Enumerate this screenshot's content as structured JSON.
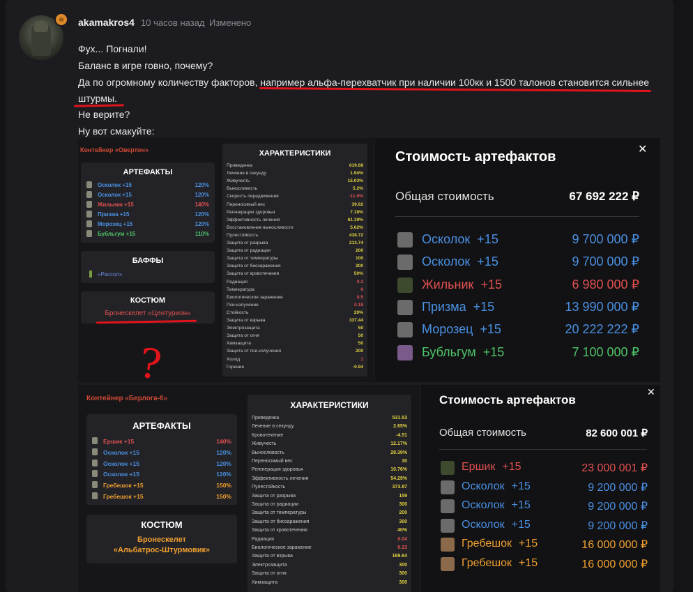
{
  "post": {
    "username": "akamakros4",
    "time": "10 часов назад",
    "edited": "Изменено",
    "badge_icon": "skull-icon",
    "lines": [
      "Фух... Погнали!",
      "Баланс в игре говно, почему?",
      "Да по огромному количеству факторов, например альфа-перехватчик при наличии 100кк и 1500 талонов становится сильнее",
      "штурмы.",
      "Не верите?",
      "Ну вот смакуйте:"
    ],
    "highlight_color": "#e0141a"
  },
  "shot1": {
    "container": "Контейнер «Овертон»",
    "artifacts_title": "АРТЕФАКТЫ",
    "artifacts": [
      {
        "name": "Осколок +15",
        "pct": "120%",
        "color": "#4a90e2"
      },
      {
        "name": "Осколок +15",
        "pct": "120%",
        "color": "#4a90e2"
      },
      {
        "name": "Жильник +15",
        "pct": "140%",
        "color": "#e05050"
      },
      {
        "name": "Призма +15",
        "pct": "120%",
        "color": "#4a90e2"
      },
      {
        "name": "Морозец +15",
        "pct": "120%",
        "color": "#4a90e2"
      },
      {
        "name": "Бубльгум +15",
        "pct": "110%",
        "color": "#4fc46a"
      }
    ],
    "buffs_title": "БАФФЫ",
    "buff": "«Рассол»",
    "suit_title": "КОСТЮМ",
    "suit": "Бронескелет «Центурион»",
    "stats_title": "ХАРАКТЕРИСТИКИ",
    "stats": [
      [
        "Приведенка",
        "619.68",
        "#e0d040"
      ],
      [
        "Лечение в секунду",
        "1.94%",
        "#e0d040"
      ],
      [
        "Живучесть",
        "15.03%",
        "#e0d040"
      ],
      [
        "Выносливость",
        "5.2%",
        "#e0d040"
      ],
      [
        "Скорость передвижения",
        "-11.9%",
        "#e05050"
      ],
      [
        "Переносимый вес",
        "39.92",
        "#e0d040"
      ],
      [
        "Регенерация здоровья",
        "7.18%",
        "#e0d040"
      ],
      [
        "Эффективность лечения",
        "61.19%",
        "#e0d040"
      ],
      [
        "Восстановление выносливости",
        "5.62%",
        "#e0d040"
      ],
      [
        "Пулестойкость",
        "438.72",
        "#e0d040"
      ],
      [
        "Защита от разрыва",
        "213.74",
        "#e0d040"
      ],
      [
        "Защита от радиации",
        "200",
        "#e0d040"
      ],
      [
        "Защита от температуры",
        "100",
        "#e0d040"
      ],
      [
        "Защита от биозаражения",
        "200",
        "#e0d040"
      ],
      [
        "Защита от кровотечения",
        "50%",
        "#e0d040"
      ],
      [
        "Радиация",
        "0.3",
        "#e05050"
      ],
      [
        "Температура",
        "0",
        "#e05050"
      ],
      [
        "Биологическое заражение",
        "0.5",
        "#e05050"
      ],
      [
        "Пси-излучение",
        "0.18",
        "#e05050"
      ],
      [
        "Стойкость",
        "20%",
        "#e0d040"
      ],
      [
        "Защита от взрыва",
        "337.44",
        "#e0d040"
      ],
      [
        "Электрозащита",
        "50",
        "#e0d040"
      ],
      [
        "Защита от огня",
        "50",
        "#e0d040"
      ],
      [
        "Химзащита",
        "50",
        "#e0d040"
      ],
      [
        "Защита от пси-излучения",
        "200",
        "#e0d040"
      ],
      [
        "Холод",
        "1",
        "#e05050"
      ],
      [
        "Горение",
        "-0.94",
        "#e0d040"
      ]
    ],
    "cost_title": "Стоимость артефактов",
    "close": "✕",
    "total_label": "Общая стоимость",
    "total_value": "67 692 222 ₽",
    "costs": [
      {
        "name": "Осколок",
        "lvl": "+15",
        "value": "9 700 000 ₽",
        "color": "#4a90e2",
        "icon": "shard-icon"
      },
      {
        "name": "Осколок",
        "lvl": "+15",
        "value": "9 700 000 ₽",
        "color": "#4a90e2",
        "icon": "shard-icon"
      },
      {
        "name": "Жильник",
        "lvl": "+15",
        "value": "6 980 000 ₽",
        "color": "#e05050",
        "icon": "vein-icon"
      },
      {
        "name": "Призма",
        "lvl": "+15",
        "value": "13 990 000 ₽",
        "color": "#4a90e2",
        "icon": "prism-icon"
      },
      {
        "name": "Морозец",
        "lvl": "+15",
        "value": "20 222 222 ₽",
        "color": "#4a90e2",
        "icon": "frost-icon"
      },
      {
        "name": "Бубльгум",
        "lvl": "+15",
        "value": "7 100 000 ₽",
        "color": "#4fc46a",
        "icon": "bubblegum-icon"
      }
    ]
  },
  "shot2": {
    "container": "Контейнер «Берлога-6»",
    "artifacts_title": "АРТЕФАКТЫ",
    "artifacts": [
      {
        "name": "Ершик +15",
        "pct": "140%",
        "color": "#e05050"
      },
      {
        "name": "Осколок +15",
        "pct": "120%",
        "color": "#4a90e2"
      },
      {
        "name": "Осколок +15",
        "pct": "120%",
        "color": "#4a90e2"
      },
      {
        "name": "Осколок +15",
        "pct": "120%",
        "color": "#4a90e2"
      },
      {
        "name": "Гребешок +15",
        "pct": "150%",
        "color": "#f0a030"
      },
      {
        "name": "Гребешок +15",
        "pct": "150%",
        "color": "#f0a030"
      }
    ],
    "suit_title": "КОСТЮМ",
    "suit_line1": "Бронескелет",
    "suit_line2": "«Альбатрос-Штурмовик»",
    "stats_title": "ХАРАКТЕРИСТИКИ",
    "stats": [
      [
        "Приведенка",
        "531.53",
        "#e0d040"
      ],
      [
        "Лечение в секунду",
        "2.65%",
        "#e0d040"
      ],
      [
        "Кровотечение",
        "-4.51",
        "#e0d040"
      ],
      [
        "Живучесть",
        "12.17%",
        "#e0d040"
      ],
      [
        "Выносливость",
        "28.39%",
        "#e0d040"
      ],
      [
        "Переносимый вес",
        "30",
        "#e0d040"
      ],
      [
        "Регенерация здоровья",
        "10.76%",
        "#e0d040"
      ],
      [
        "Эффективность лечения",
        "54.29%",
        "#e0d040"
      ],
      [
        "Пулестойкость",
        "373.87",
        "#e0d040"
      ],
      [
        "Защита от разрыва",
        "159",
        "#e0d040"
      ],
      [
        "Защита от радиации",
        "300",
        "#e0d040"
      ],
      [
        "Защита от температуры",
        "200",
        "#e0d040"
      ],
      [
        "Защита от биозаражения",
        "300",
        "#e0d040"
      ],
      [
        "Защита от кровотечения",
        "40%",
        "#e0d040"
      ],
      [
        "Радиация",
        "0.04",
        "#e05050"
      ],
      [
        "Биологическое заражение",
        "0.23",
        "#e05050"
      ],
      [
        "Защита от взрыва",
        "169.64",
        "#e0d040"
      ],
      [
        "Электрозащита",
        "300",
        "#e0d040"
      ],
      [
        "Защита от огня",
        "300",
        "#e0d040"
      ],
      [
        "Химзащита",
        "300",
        "#e0d040"
      ]
    ],
    "cost_title": "Стоимость артефактов",
    "close": "✕",
    "total_label": "Общая стоимость",
    "total_value": "82 600 001 ₽",
    "costs": [
      {
        "name": "Ершик",
        "lvl": "+15",
        "value": "23 000 001 ₽",
        "color": "#e05050",
        "icon": "urchin-icon"
      },
      {
        "name": "Осколок",
        "lvl": "+15",
        "value": "9 200 000 ₽",
        "color": "#4a90e2",
        "icon": "shard-icon"
      },
      {
        "name": "Осколок",
        "lvl": "+15",
        "value": "9 200 000 ₽",
        "color": "#4a90e2",
        "icon": "shard-icon"
      },
      {
        "name": "Осколок",
        "lvl": "+15",
        "value": "9 200 000 ₽",
        "color": "#4a90e2",
        "icon": "shard-icon"
      },
      {
        "name": "Гребешок",
        "lvl": "+15",
        "value": "16 000 000 ₽",
        "color": "#f0a030",
        "icon": "comb-icon"
      },
      {
        "name": "Гребешок",
        "lvl": "+15",
        "value": "16 000 000 ₽",
        "color": "#f0a030",
        "icon": "comb-icon"
      }
    ]
  },
  "annotation": {
    "question_mark": "?"
  }
}
